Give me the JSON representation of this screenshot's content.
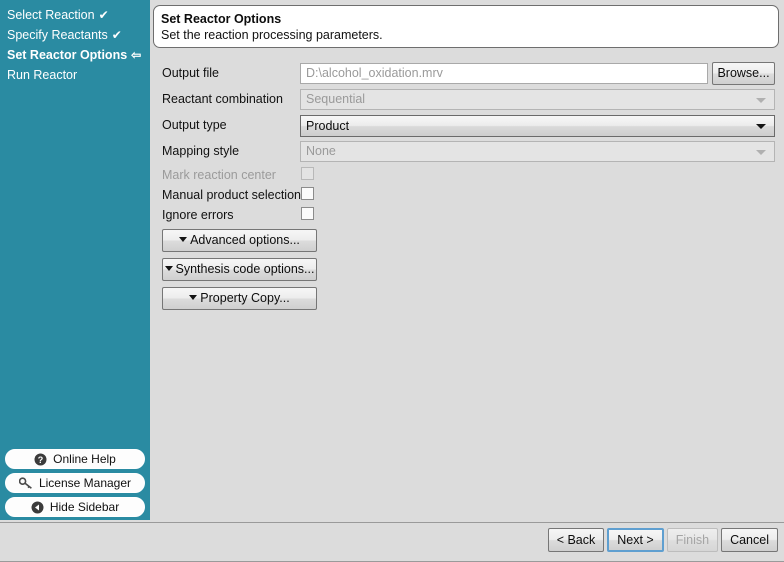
{
  "sidebar": {
    "steps": [
      {
        "label": "Select Reaction",
        "mark": "✔",
        "state": "done"
      },
      {
        "label": "Specify Reactants",
        "mark": "✔",
        "state": "done"
      },
      {
        "label": "Set Reactor Options",
        "mark": "⇦",
        "state": "current"
      },
      {
        "label": "Run Reactor",
        "mark": "",
        "state": "pending"
      }
    ],
    "buttons": [
      {
        "label": "Online Help",
        "icon": "help-circle-icon"
      },
      {
        "label": "License Manager",
        "icon": "key-icon"
      },
      {
        "label": "Hide Sidebar",
        "icon": "back-circle-icon"
      }
    ]
  },
  "header": {
    "title": "Set Reactor Options",
    "subtitle": "Set the reaction processing parameters."
  },
  "form": {
    "output_file": {
      "label": "Output file",
      "value": "",
      "placeholder": "D:\\alcohol_oxidation.mrv",
      "browse_label": "Browse..."
    },
    "reactant_combination": {
      "label": "Reactant combination",
      "value": "Sequential",
      "enabled": false
    },
    "output_type": {
      "label": "Output type",
      "value": "Product",
      "enabled": true
    },
    "mapping_style": {
      "label": "Mapping style",
      "value": "None",
      "enabled": false
    },
    "checkboxes": [
      {
        "label": "Mark reaction center",
        "checked": false,
        "enabled": false
      },
      {
        "label": "Manual product selection",
        "checked": false,
        "enabled": true
      },
      {
        "label": "Ignore errors",
        "checked": false,
        "enabled": true
      }
    ],
    "option_buttons": [
      {
        "label": "Advanced options..."
      },
      {
        "label": "Synthesis code options..."
      },
      {
        "label": "Property Copy..."
      }
    ]
  },
  "footer": {
    "back_label": "< Back",
    "next_label": "Next >",
    "finish_label": "Finish",
    "cancel_label": "Cancel"
  },
  "colors": {
    "sidebar_bg": "#2a8ba2",
    "panel_bg": "#dcdcdc",
    "focus_border": "#5f9fd0"
  }
}
